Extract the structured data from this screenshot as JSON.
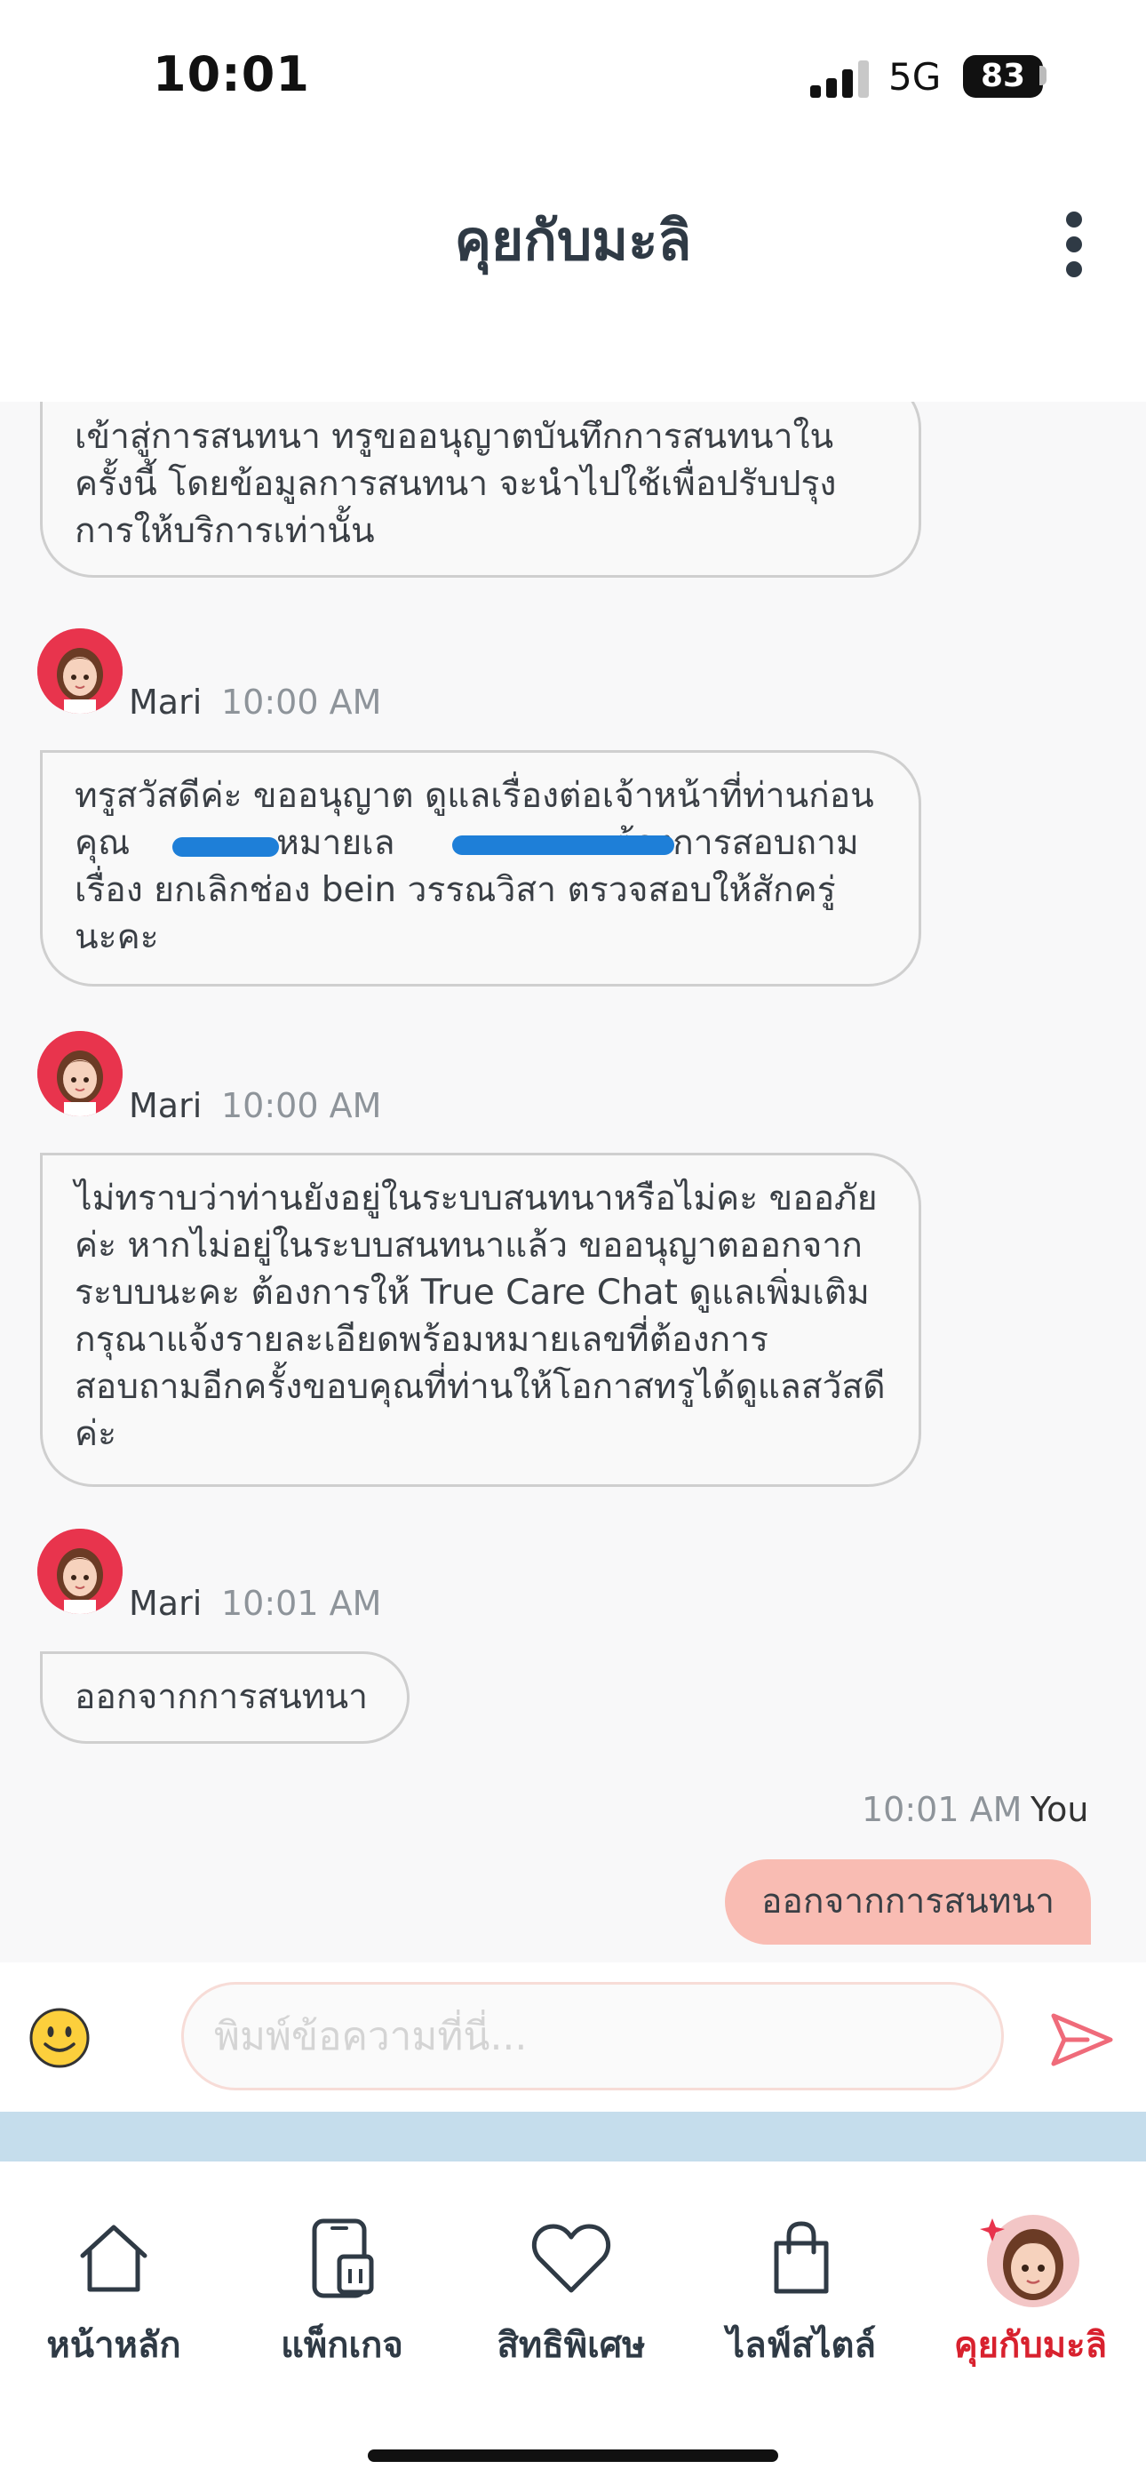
{
  "status_bar": {
    "time": "10:01",
    "network": "5G",
    "battery": "83"
  },
  "header": {
    "title": "คุยกับมะลิ",
    "menu_icon": "more-vertical-icon"
  },
  "messages": [
    {
      "type": "bot",
      "text": "เข้าสู่การสนทนา ทรูขออนุญาตบันทึกการสนทนาในครั้งนี้ โดยข้อมูลการสนทนา จะนำไปใช้เพื่อปรับปรุงการให้บริการเท่านั้น"
    },
    {
      "type": "bot",
      "sender": "Mari",
      "time": "10:00 AM",
      "line1": "ทรูสวัสดีค่ะ ขออนุญาต ดูแลเรื่องต่อเจ้าหน้าที่ท่านก่อน",
      "line2a": "คุณ",
      "line2b": "หมายเล",
      "line2c": "ต้องการสอบถาม",
      "line3": "เรื่อง ยกเลิกช่อง bein วรรณวิสา ตรวจสอบให้สักครู่",
      "line4": "นะคะ"
    },
    {
      "type": "bot",
      "sender": "Mari",
      "time": "10:00 AM",
      "text": "ไม่ทราบว่าท่านยังอยู่ในระบบสนทนาหรือไม่คะ ขออภัยค่ะ หากไม่อยู่ในระบบสนทนาแล้ว ขออนุญาตออกจากระบบนะคะ ต้องการให้ True Care Chat ดูแลเพิ่มเติม กรุณาแจ้งรายละเอียดพร้อมหมายเลขที่ต้องการสอบถามอีกครั้งขอบคุณที่ท่านให้โอกาสทรูได้ดูแลสวัสดีค่ะ"
    },
    {
      "type": "bot",
      "sender": "Mari",
      "time": "10:01 AM",
      "text": "ออกจากการสนทนา"
    },
    {
      "type": "user",
      "sender": "You",
      "time": "10:01 AM",
      "text": "ออกจากการสนทนา"
    }
  ],
  "composer": {
    "placeholder": "พิมพ์ข้อความที่นี่...",
    "emoji_icon": "emoji-icon",
    "send_icon": "send-icon"
  },
  "nav": [
    {
      "label": "หน้าหลัก",
      "icon": "home-icon"
    },
    {
      "label": "แพ็กเกจ",
      "icon": "phone-sim-icon"
    },
    {
      "label": "สิทธิพิเศษ",
      "icon": "heart-icon"
    },
    {
      "label": "ไลฟ์สไตล์",
      "icon": "shopping-bag-icon"
    },
    {
      "label": "คุยกับมะลิ",
      "icon": "mali-avatar-icon",
      "active": true
    }
  ],
  "colors": {
    "accent": "#d8212e",
    "user_bubble": "#f9bcb3",
    "strip": "#c5ddec",
    "avatar_bg": "#e8344d",
    "send": "#ef6b7a",
    "redaction": "#1e7fd8"
  }
}
